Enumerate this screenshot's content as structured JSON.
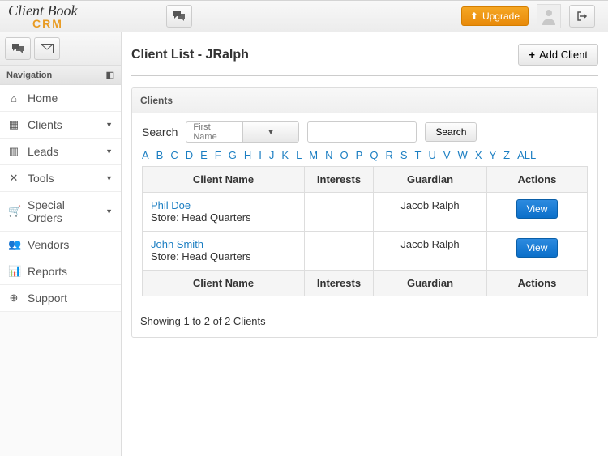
{
  "logo": {
    "top": "Client Book",
    "bottom": "CRM"
  },
  "topbar": {
    "upgrade": "Upgrade"
  },
  "sidebar": {
    "nav_header": "Navigation",
    "items": [
      {
        "icon": "⌂",
        "label": "Home",
        "caret": false
      },
      {
        "icon": "▦",
        "label": "Clients",
        "caret": true
      },
      {
        "icon": "▥",
        "label": "Leads",
        "caret": true
      },
      {
        "icon": "✕",
        "label": "Tools",
        "caret": true
      },
      {
        "icon": "🛒",
        "label": "Special Orders",
        "caret": true
      },
      {
        "icon": "👥",
        "label": "Vendors",
        "caret": false
      },
      {
        "icon": "📊",
        "label": "Reports",
        "caret": false
      },
      {
        "icon": "⊕",
        "label": "Support",
        "caret": false
      }
    ]
  },
  "page": {
    "title": "Client List - JRalph",
    "add_client": "Add Client"
  },
  "panel": {
    "header": "Clients",
    "search_label": "Search",
    "search_field": "First Name",
    "search_btn": "Search",
    "alpha": [
      "A",
      "B",
      "C",
      "D",
      "E",
      "F",
      "G",
      "H",
      "I",
      "J",
      "K",
      "L",
      "M",
      "N",
      "O",
      "P",
      "Q",
      "R",
      "S",
      "T",
      "U",
      "V",
      "W",
      "X",
      "Y",
      "Z",
      "ALL"
    ],
    "columns": {
      "name": "Client Name",
      "interests": "Interests",
      "guardian": "Guardian",
      "actions": "Actions"
    },
    "rows": [
      {
        "name": "Phil Doe",
        "store": "Store: Head Quarters",
        "interests": "",
        "guardian": "Jacob Ralph",
        "action": "View"
      },
      {
        "name": "John Smith",
        "store": "Store: Head Quarters",
        "interests": "",
        "guardian": "Jacob Ralph",
        "action": "View"
      }
    ],
    "footer": "Showing 1 to 2 of 2 Clients"
  }
}
